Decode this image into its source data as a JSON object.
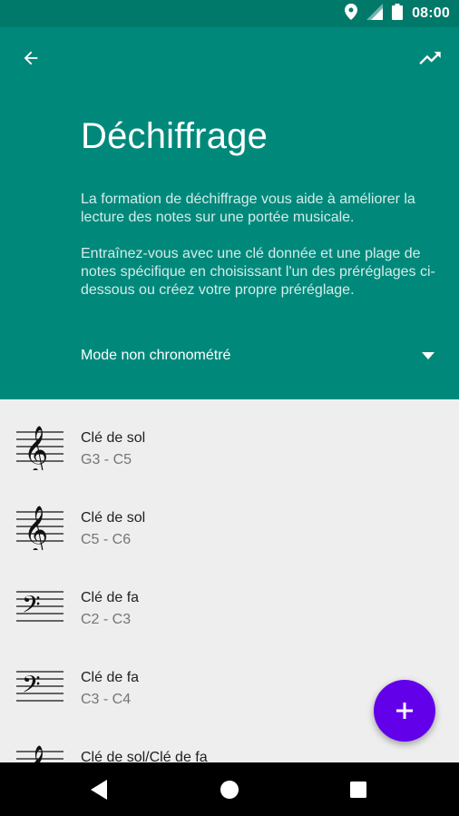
{
  "status_bar": {
    "time": "08:00",
    "icons": [
      "location-icon",
      "signal-icon",
      "battery-icon"
    ]
  },
  "header": {
    "title": "Déchiffrage",
    "description_1": "La formation de déchiffrage vous aide à améliorer la lecture des notes sur une portée musicale.",
    "description_2": "Entraînez-vous avec une clé donnée et une plage de notes spécifique en choisissant l'un des préréglages ci-dessous ou créez votre propre préréglage.",
    "mode": {
      "selected": "Mode non chronométré"
    }
  },
  "presets": [
    {
      "clef": "treble",
      "name": "Clé de sol",
      "range": "G3 - C5"
    },
    {
      "clef": "treble",
      "name": "Clé de sol",
      "range": "C5 - C6"
    },
    {
      "clef": "bass",
      "name": "Clé de fa",
      "range": "C2 - C3"
    },
    {
      "clef": "bass",
      "name": "Clé de fa",
      "range": "C3 - C4"
    },
    {
      "clef": "treble",
      "name": "Clé de sol/Clé de fa",
      "range": ""
    }
  ],
  "fab": {
    "icon": "plus-icon"
  },
  "colors": {
    "status_bar": "#00796b",
    "header": "#00897b",
    "list_bg": "#eeeeee",
    "fab": "#6200ea"
  }
}
